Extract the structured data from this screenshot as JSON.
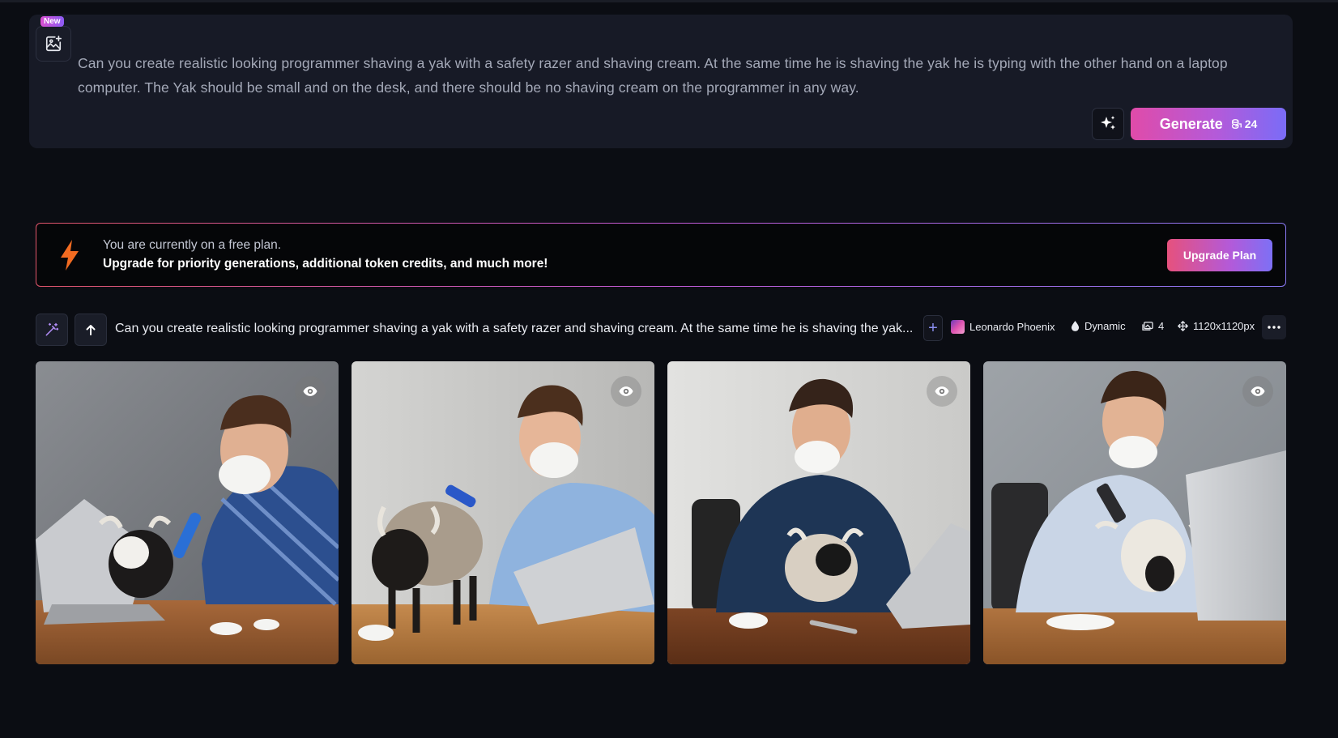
{
  "prompt_panel": {
    "new_badge": "New",
    "prompt_text": "Can you create realistic looking programmer shaving a yak with a safety razer and shaving cream.  At the same time he is shaving the yak he is typing with  the other hand on a laptop computer.  The Yak should be small and on the desk, and there should be no shaving cream on the programmer in any way.",
    "generate_label": "Generate",
    "generate_cost": "24"
  },
  "plan_banner": {
    "line1": "You are currently on a free plan.",
    "line2": "Upgrade for priority generations, additional token credits, and much more!",
    "upgrade_label": "Upgrade Plan"
  },
  "generation": {
    "prompt": "Can you create realistic looking programmer shaving a yak with a safety razer and shaving cream. At the same time he is shaving the yak...",
    "model": "Leonardo Phoenix",
    "style": "Dynamic",
    "image_count": "4",
    "dimensions": "1120x1120px"
  },
  "icons": {
    "image_prompt": "image-plus-icon",
    "improve_prompt": "sparkle-icon",
    "token": "coin-stack-icon",
    "bolt": "lightning-bolt-icon",
    "magic_wand": "magic-wand-icon",
    "reuse": "arrow-up-icon",
    "style": "droplet-icon",
    "count": "images-icon",
    "dimensions": "move-icon",
    "more": "ellipsis-icon",
    "view": "eye-icon"
  },
  "colors": {
    "background": "#0b0d13",
    "panel": "#171a26",
    "accent_pink": "#e04ba9",
    "accent_violet": "#7a6cf7",
    "bolt_orange": "#f26b21"
  }
}
